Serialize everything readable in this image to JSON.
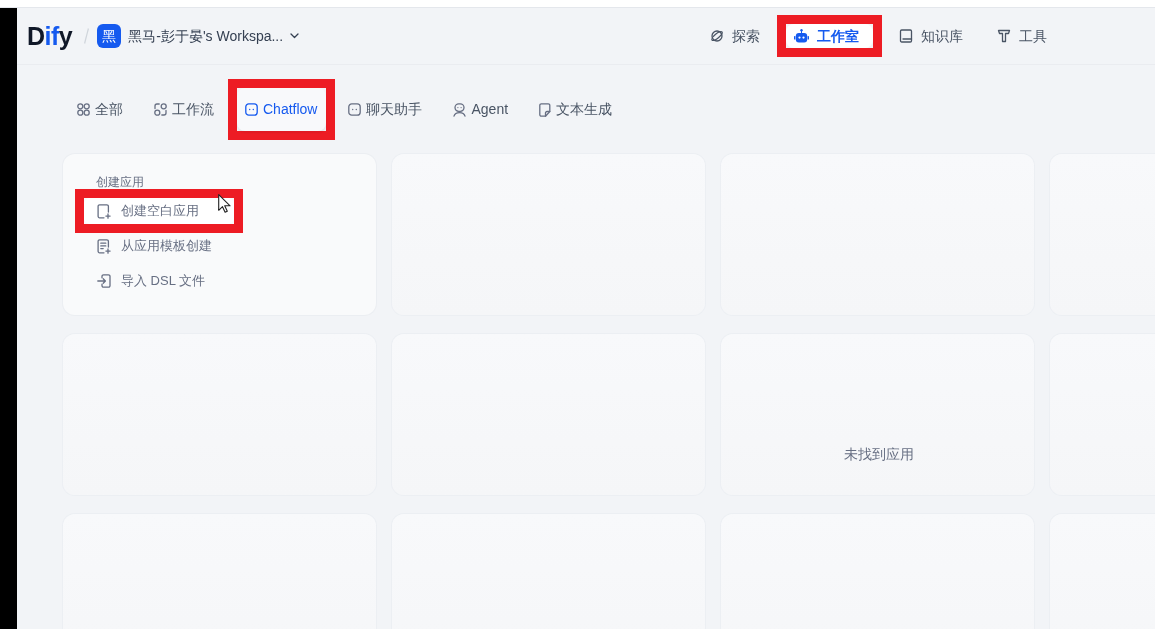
{
  "header": {
    "logo": {
      "parts": [
        {
          "text": "D",
          "accent": false
        },
        {
          "text": "if",
          "accent": true
        },
        {
          "text": "y",
          "accent": false
        }
      ]
    },
    "workspace": {
      "avatar": "黑",
      "name": "黑马-彭于晏's Workspa..."
    }
  },
  "nav": [
    {
      "label": "探索",
      "selected": false,
      "annotated": false
    },
    {
      "label": "工作室",
      "selected": true,
      "annotated": true
    },
    {
      "label": "知识库",
      "selected": false,
      "annotated": false
    },
    {
      "label": "工具",
      "selected": false,
      "annotated": false
    }
  ],
  "tabs": [
    {
      "label": "全部",
      "selected": false,
      "annotated": false
    },
    {
      "label": "工作流",
      "selected": false,
      "annotated": false
    },
    {
      "label": "Chatflow",
      "selected": true,
      "annotated": true
    },
    {
      "label": "聊天助手",
      "selected": false,
      "annotated": false
    },
    {
      "label": "Agent",
      "selected": false,
      "annotated": false
    },
    {
      "label": "文本生成",
      "selected": false,
      "annotated": false
    }
  ],
  "create_card": {
    "title": "创建应用",
    "items": [
      {
        "label": "创建空白应用",
        "hovered": true,
        "annotated": true
      },
      {
        "label": "从应用模板创建",
        "hovered": false,
        "annotated": false
      },
      {
        "label": "导入 DSL 文件",
        "hovered": false,
        "annotated": false
      }
    ]
  },
  "empty_state": {
    "text": "未找到应用"
  }
}
